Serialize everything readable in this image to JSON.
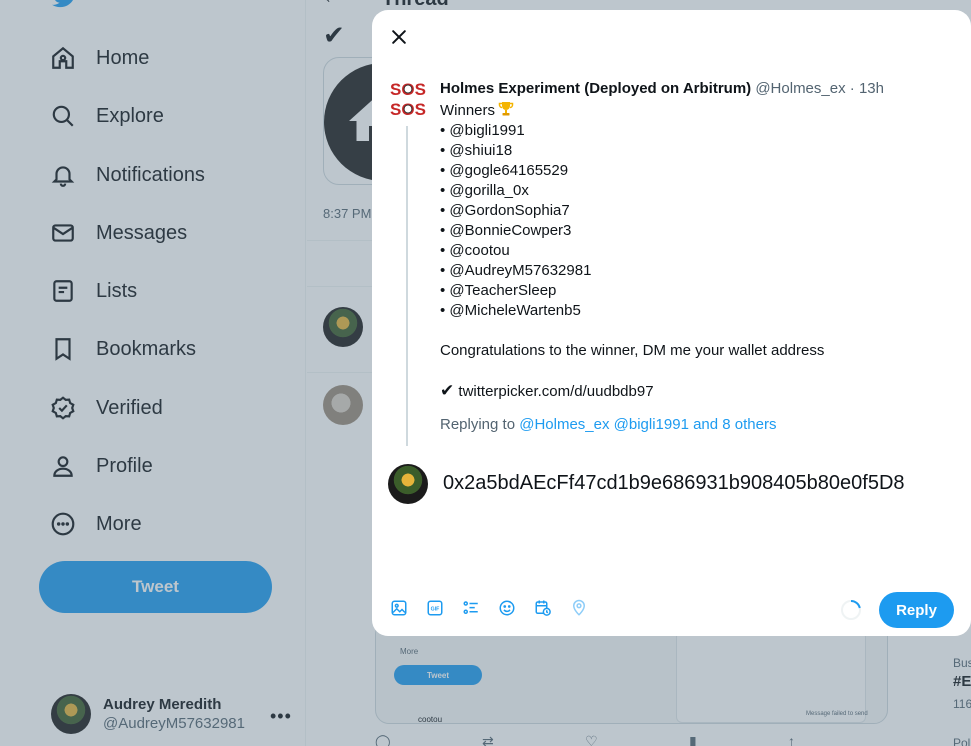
{
  "sidebar": {
    "items": [
      {
        "label": "Home",
        "icon": "home-icon"
      },
      {
        "label": "Explore",
        "icon": "search-icon"
      },
      {
        "label": "Notifications",
        "icon": "bell-icon"
      },
      {
        "label": "Messages",
        "icon": "envelope-icon"
      },
      {
        "label": "Lists",
        "icon": "list-icon"
      },
      {
        "label": "Bookmarks",
        "icon": "bookmark-icon"
      },
      {
        "label": "Verified",
        "icon": "verified-icon"
      },
      {
        "label": "Profile",
        "icon": "person-icon"
      },
      {
        "label": "More",
        "icon": "more-circle-icon"
      }
    ],
    "tweet_label": "Tweet",
    "account": {
      "name": "Audrey Meredith",
      "handle": "@AudreyM57632981"
    }
  },
  "main": {
    "title": "Thread",
    "time": "8:37 PM",
    "screenshot": {
      "more": "More",
      "tweet": "Tweet",
      "user": "cootou",
      "message": "Message failed to send"
    }
  },
  "right_col": {
    "text1": "Bus",
    "text2": "#E",
    "text3": "116",
    "text4": "Poli"
  },
  "modal": {
    "original": {
      "name": "Holmes Experiment (Deployed on Arbitrum)",
      "handle": "@Holmes_ex",
      "separator": "·",
      "time": "13h",
      "winners_label": "Winners",
      "winners": [
        "• @bigli1991",
        "• @shiui18",
        "• @gogle64165529",
        "• @gorilla_0x",
        "• @GordonSophia7",
        "• @BonnieCowper3",
        "• @cootou",
        "• @AudreyM57632981",
        "• @TeacherSleep",
        "• @MicheleWartenb5"
      ],
      "congrats": "Congratulations to the winner, DM me your wallet address",
      "link_check": "✔",
      "link": "twitterpicker.com/d/uudbdb97",
      "replying_prefix": "Replying to",
      "replying_link": "@Holmes_ex @bigli1991 and 8 others"
    },
    "reply_text": "0x2a5bdAEcFf47cd1b9e686931b908405b80e0f5D8",
    "reply_button": "Reply",
    "toolbar": [
      "image-icon",
      "gif-icon",
      "poll-icon",
      "emoji-icon",
      "schedule-icon",
      "location-icon"
    ]
  },
  "colors": {
    "accent": "#1d9bf0",
    "text": "#0f1419",
    "muted": "#536471"
  }
}
